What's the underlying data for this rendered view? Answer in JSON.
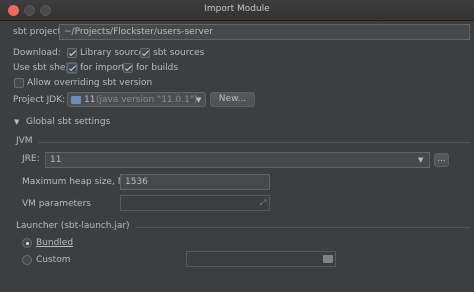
{
  "window": {
    "title": "Import Module"
  },
  "sbt_project": {
    "label": "sbt project:",
    "value": "~/Projects/Flockster/users-server"
  },
  "download": {
    "label": "Download:",
    "library_sources": {
      "label": "Library sources",
      "checked": true
    },
    "sbt_sources": {
      "label": "sbt sources",
      "checked": true
    }
  },
  "sbt_shell": {
    "label": "Use sbt shell:",
    "for_imports": {
      "label": "for imports",
      "checked": true
    },
    "for_builds": {
      "label": "for builds",
      "checked": true
    }
  },
  "overriding": {
    "label": "Allow overriding sbt version",
    "checked": false
  },
  "project_jdk": {
    "label": "Project JDK:",
    "value": "11",
    "detail": "(java version \"11.0.1\")",
    "new_button": "New..."
  },
  "global_settings": {
    "label": "Global sbt settings",
    "jvm_label": "JVM",
    "jre": {
      "label": "JRE:",
      "value": "11",
      "browse": "..."
    },
    "max_heap": {
      "label": "Maximum heap size, MB",
      "value": "1536"
    },
    "vm_params": {
      "label": "VM parameters",
      "value": ""
    },
    "launcher": {
      "label": "Launcher (sbt-launch.jar)",
      "bundled": {
        "label": "Bundled",
        "selected": true
      },
      "custom": {
        "label": "Custom",
        "selected": false,
        "path": ""
      }
    }
  }
}
